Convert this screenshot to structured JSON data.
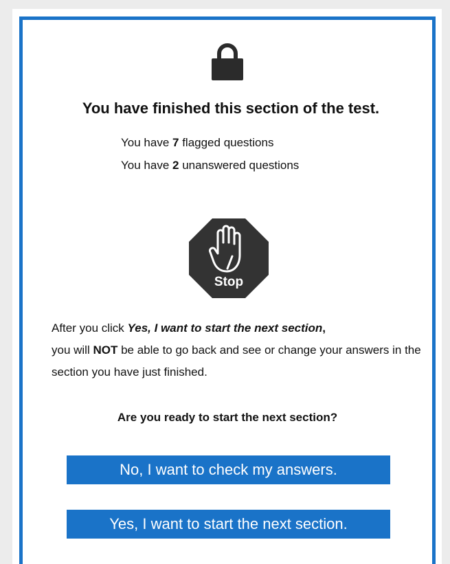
{
  "dialog": {
    "lock_icon": "lock-icon",
    "title": "You have finished this section of the test.",
    "flagged": {
      "prefix": "You have ",
      "count": "7",
      "suffix": " flagged questions"
    },
    "unanswered": {
      "prefix": "You have ",
      "count": "2",
      "suffix": " unanswered questions"
    },
    "stop_icon": "stop-hand-icon",
    "stop_label": "Stop",
    "warning": {
      "part1": "After you click ",
      "emphasis": "Yes, I want to start the next section",
      "part2": ",",
      "part3": "you will ",
      "not": "NOT",
      "part4": " be able to go back and see or change your answers in the section you have just finished."
    },
    "question": "Are you ready to start the next section?",
    "no_button": "No, I want to check my answers.",
    "yes_button": "Yes, I want to start the next section."
  },
  "colors": {
    "accent": "#1a73c8",
    "stop": "#333333",
    "background": "#ececec"
  }
}
